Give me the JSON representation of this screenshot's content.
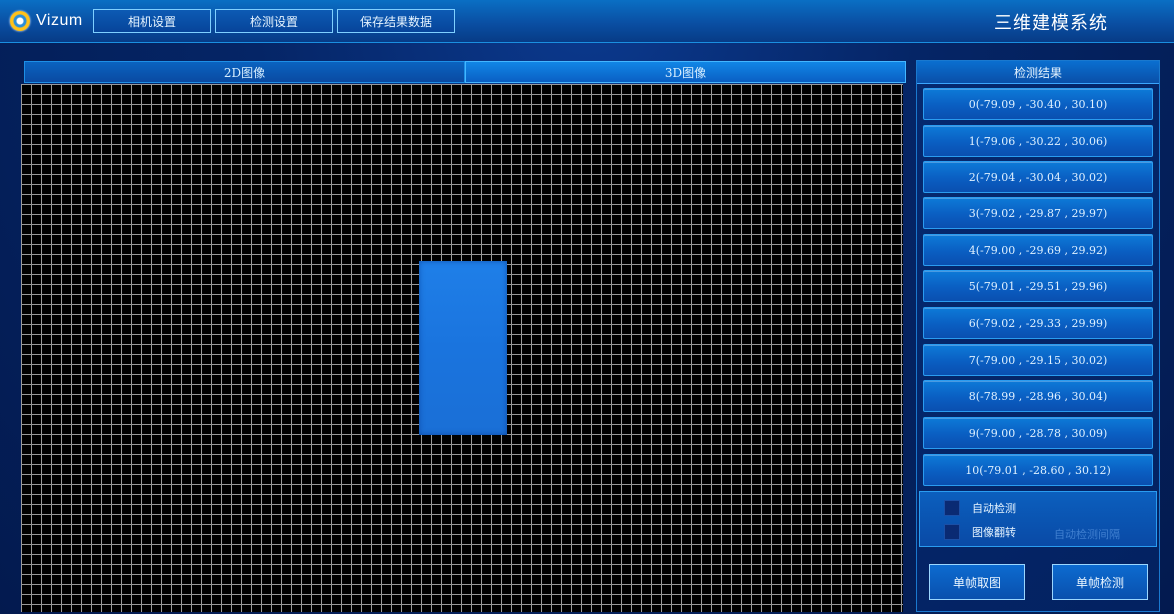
{
  "app": {
    "logo_text": "Vizum",
    "title": "三维建模系统"
  },
  "menu": {
    "camera_settings": "相机设置",
    "detection_settings": "检测设置",
    "save_results": "保存结果数据"
  },
  "tabs": {
    "tab_2d": "2D图像",
    "tab_3d": "3D图像"
  },
  "results": {
    "header": "检测结果",
    "rows": [
      "0(-79.09 , -30.40 , 30.10)",
      "1(-79.06 , -30.22 , 30.06)",
      "2(-79.04 , -30.04 , 30.02)",
      "3(-79.02 , -29.87 , 29.97)",
      "4(-79.00 , -29.69 , 29.92)",
      "5(-79.01 , -29.51 , 29.96)",
      "6(-79.02 , -29.33 , 29.99)",
      "7(-79.00 , -29.15 , 30.02)",
      "8(-78.99 , -28.96 , 30.04)",
      "9(-79.00 , -28.78 , 30.09)",
      "10(-79.01 , -28.60 , 30.12)"
    ]
  },
  "options": {
    "auto_detect": "自动检测",
    "image_flip": "图像翻转",
    "faint_text": "自动检测间隔"
  },
  "actions": {
    "single_capture": "单帧取图",
    "single_detect": "单帧检测"
  },
  "colors": {
    "accent": "#1a74de",
    "background": "#031a4f",
    "grid": "#9a9a9a"
  }
}
